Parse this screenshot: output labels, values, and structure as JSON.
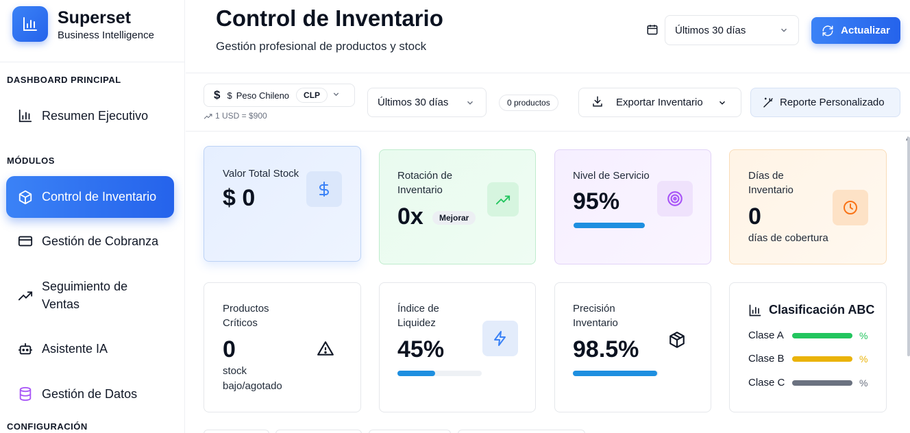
{
  "brand": {
    "title": "Superset",
    "subtitle": "Business Intelligence"
  },
  "sidebar": {
    "sections": [
      {
        "label": "DASHBOARD PRINCIPAL"
      },
      {
        "label": "MÓDULOS"
      },
      {
        "label": "CONFIGURACIÓN"
      }
    ],
    "items": [
      {
        "label": "Resumen Ejecutivo",
        "icon": "bar-chart-icon"
      },
      {
        "label": "Control de Inventario",
        "icon": "box-icon",
        "active": true
      },
      {
        "label": "Gestión de Cobranza",
        "icon": "credit-card-icon"
      },
      {
        "label": "Seguimiento de Ventas",
        "icon": "trending-up-icon"
      },
      {
        "label": "Asistente IA",
        "icon": "bot-icon"
      },
      {
        "label": "Gestión de Datos",
        "icon": "database-icon"
      }
    ]
  },
  "header": {
    "title": "Control de Inventario",
    "subtitle": "Gestión profesional de productos y stock",
    "period": "Últimos 30 días",
    "refresh_label": "Actualizar"
  },
  "toolbar": {
    "currency_symbol": "$",
    "currency_name": "Peso Chileno",
    "currency_code": "CLP",
    "rate": "1 USD = $900",
    "period": "Últimos 30 días",
    "product_count": "0 productos",
    "export_label": "Exportar Inventario",
    "report_label": "Reporte Personalizado"
  },
  "cards": {
    "stock_value": {
      "label": "Valor Total Stock",
      "value": "$ 0"
    },
    "rotation": {
      "label": "Rotación de Inventario",
      "value": "0x",
      "badge": "Mejorar"
    },
    "service": {
      "label": "Nivel de Servicio",
      "value": "95%",
      "progress": 0.95
    },
    "days": {
      "label": "Días de Inventario",
      "value": "0",
      "note": "días de cobertura"
    },
    "critical": {
      "label": "Productos Críticos",
      "value": "0",
      "note": "stock bajo/agotado"
    },
    "liquidity": {
      "label": "Índice de Liquidez",
      "value": "45%",
      "progress": 0.45
    },
    "accuracy": {
      "label": "Precisión Inventario",
      "value": "98.5%",
      "progress": 0.985
    },
    "abc": {
      "title": "Clasificación ABC",
      "rows": [
        {
          "label": "Clase A",
          "pct": "%",
          "color": "#22c55e"
        },
        {
          "label": "Clase B",
          "pct": "%",
          "color": "#eab308"
        },
        {
          "label": "Clase C",
          "pct": "%",
          "color": "#6b7280"
        }
      ]
    }
  },
  "colors": {
    "accent": "#2563eb",
    "progress": "#1e8fe0"
  }
}
